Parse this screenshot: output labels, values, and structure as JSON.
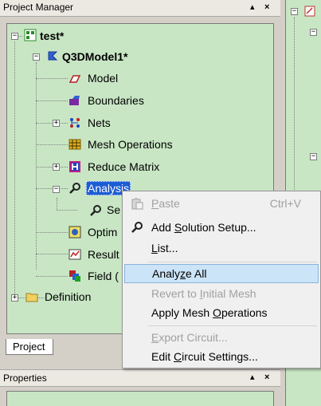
{
  "panel": {
    "title": "Project Manager",
    "pin_glyph": "▴",
    "close_glyph": "×"
  },
  "tree": {
    "project": "test*",
    "design": "Q3DModel1*",
    "items": {
      "model": "Model",
      "boundaries": "Boundaries",
      "nets": "Nets",
      "mesh": "Mesh Operations",
      "reduce": "Reduce Matrix",
      "analysis": "Analysis",
      "setup": "Se",
      "optim": "Optim",
      "results": "Result",
      "field": "Field (",
      "definitions": "Definition"
    },
    "expander_plus": "+",
    "expander_minus": "−"
  },
  "tabs": {
    "project": "Project"
  },
  "properties": {
    "title": "Properties",
    "pin_glyph": "▴",
    "close_glyph": "×"
  },
  "context_menu": {
    "items": [
      {
        "label": "Paste",
        "shortcut": "Ctrl+V",
        "disabled": true
      },
      {
        "label": "Add Solution Setup...",
        "disabled": false
      },
      {
        "label": "List...",
        "disabled": false
      },
      {
        "label": "Analyze All",
        "disabled": false,
        "highlighted": true
      },
      {
        "label": "Revert to Initial Mesh",
        "disabled": true
      },
      {
        "label": "Apply Mesh Operations",
        "disabled": false
      },
      {
        "label": "Export Circuit...",
        "disabled": true
      },
      {
        "label": "Edit Circuit Settings...",
        "disabled": false
      }
    ]
  },
  "colors": {
    "tree_bg": "#c8e6c4",
    "selection": "#1c5cd4",
    "menu_highlight": "#cce4f7"
  }
}
